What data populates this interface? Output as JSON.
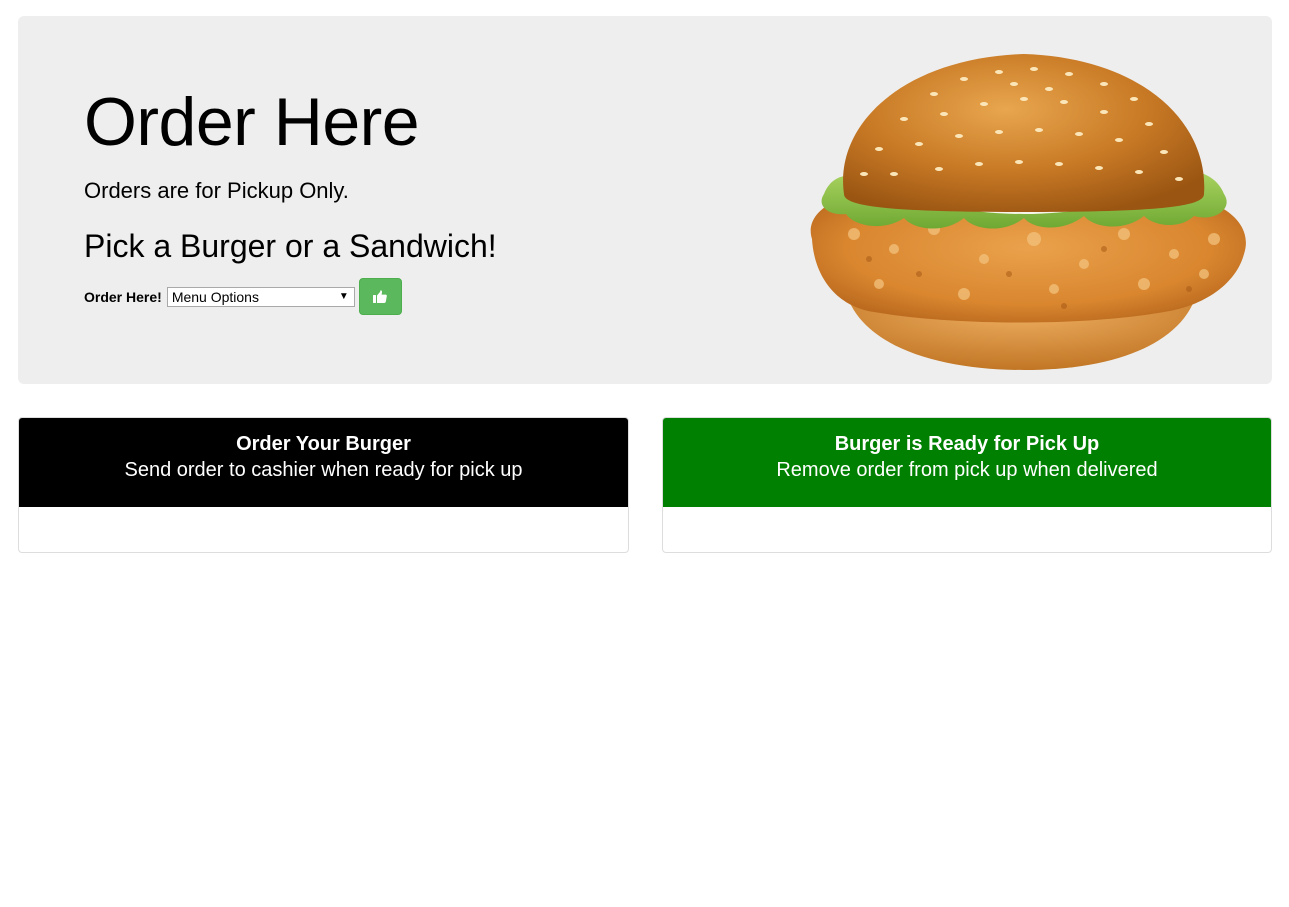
{
  "hero": {
    "title": "Order Here",
    "lead": "Orders are for Pickup Only.",
    "subtitle": "Pick a Burger or a Sandwich!",
    "order_label": "Order Here!",
    "select_value": "Menu Options",
    "submit_icon": "thumbs-up-icon",
    "image_alt": "chicken burger",
    "background_color": "#eeeeee",
    "button_color": "#5cb85c"
  },
  "panels": {
    "order": {
      "title": "Order Your Burger",
      "text": "Send order to cashier when ready for pick up",
      "color": "#000000"
    },
    "ready": {
      "title": "Burger is Ready for Pick Up",
      "text": "Remove order from pick up when delivered",
      "color": "#008000"
    }
  }
}
